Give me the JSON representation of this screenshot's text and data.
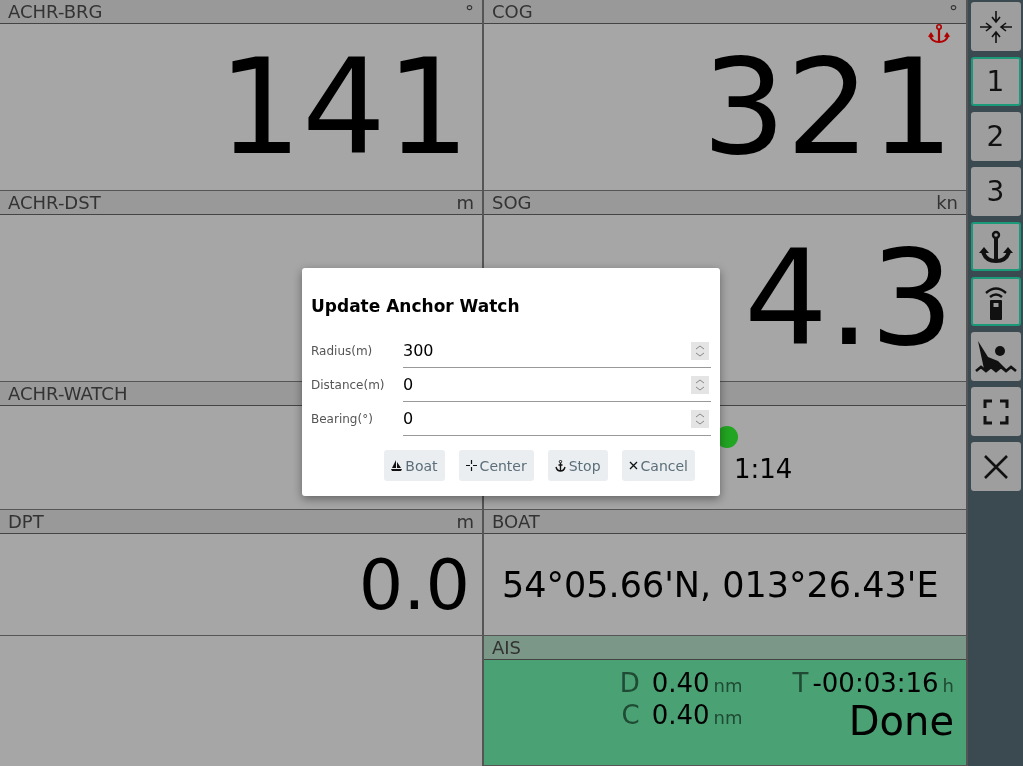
{
  "panels": [
    {
      "kind": "large",
      "title": "ACHR-BRG",
      "unit": "°",
      "value": "141"
    },
    {
      "kind": "large",
      "title": "COG",
      "unit": "°",
      "value": "321",
      "alarm": true
    },
    {
      "kind": "large",
      "title": "ACHR-DST",
      "unit": "m"
    },
    {
      "kind": "large",
      "title": "SOG",
      "unit": "kn",
      "value": "4.3"
    },
    {
      "kind": "medium",
      "title": "ACHR-WATCH"
    },
    {
      "kind": "status",
      "color": "#22a522",
      "value": "1:14"
    },
    {
      "kind": "medium",
      "title": "DPT",
      "unit": "m",
      "value": "0.0"
    },
    {
      "kind": "position",
      "title": "BOAT",
      "value": "54°05.66'N, 013°26.43'E"
    },
    {
      "kind": "empty"
    },
    {
      "kind": "ais",
      "title": "AIS",
      "rows": [
        {
          "label": "D",
          "value": "0.40",
          "unit": "nm"
        },
        {
          "label": "C",
          "value": "0.40",
          "unit": "nm"
        }
      ],
      "time_label": "T",
      "time": "-00:03:16",
      "time_unit": "h",
      "state": "Done"
    }
  ],
  "sidebar": [
    {
      "kind": "collapse",
      "selected": false
    },
    {
      "kind": "page",
      "label": "1",
      "selected": true
    },
    {
      "kind": "page",
      "label": "2",
      "selected": false
    },
    {
      "kind": "page",
      "label": "3",
      "selected": false
    },
    {
      "kind": "anchor",
      "selected": true
    },
    {
      "kind": "remote",
      "selected": true
    },
    {
      "kind": "mob",
      "selected": false
    },
    {
      "kind": "fullscreen",
      "selected": false
    },
    {
      "kind": "close",
      "selected": false
    }
  ],
  "dialog": {
    "title": "Update Anchor Watch",
    "fields": [
      {
        "label": "Radius(m)",
        "value": "300"
      },
      {
        "label": "Distance(m)",
        "value": "0"
      },
      {
        "label": "Bearing(°)",
        "value": "0"
      }
    ],
    "buttons": [
      {
        "kind": "boat",
        "label": "Boat"
      },
      {
        "kind": "center",
        "label": "Center"
      },
      {
        "kind": "stop",
        "label": "Stop"
      },
      {
        "kind": "cancel",
        "label": "Cancel"
      }
    ]
  }
}
